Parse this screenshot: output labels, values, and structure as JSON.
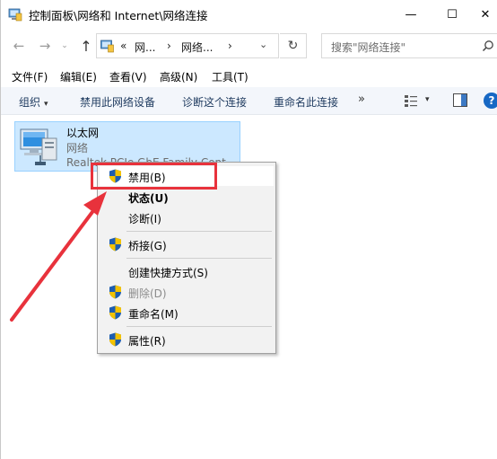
{
  "window": {
    "title": "控制面板\\网络和 Internet\\网络连接",
    "min_glyph": "—",
    "max_glyph": "☐",
    "close_glyph": "✕"
  },
  "nav": {
    "back_glyph": "←",
    "fwd_glyph": "→",
    "recent_glyph": "⌄",
    "up_glyph": "↑",
    "address_overflow": "«",
    "address_seg1": "网...",
    "address_sep1": "›",
    "address_seg2": "网络...",
    "address_sep2": "›",
    "address_dropdown_glyph": "⌄",
    "refresh_glyph": "↻",
    "search_placeholder": "搜索\"网络连接\""
  },
  "menubar": {
    "items": [
      "文件(F)",
      "编辑(E)",
      "查看(V)",
      "高级(N)",
      "工具(T)"
    ]
  },
  "commandbar": {
    "organize": "组织",
    "organize_arrow": "▾",
    "disable_device": "禁用此网络设备",
    "diagnose": "诊断这个连接",
    "rename": "重命名此连接",
    "more": "»",
    "view_arrow": "▾",
    "help": "?"
  },
  "connection": {
    "name": "以太网",
    "status": "网络",
    "device": "Realtek PCIe GbE Family Cont..."
  },
  "context_menu": {
    "items": [
      {
        "label": "禁用(B)",
        "shield": true,
        "bold": false,
        "disabled": false
      },
      {
        "label": "状态(U)",
        "shield": false,
        "bold": true,
        "disabled": false
      },
      {
        "label": "诊断(I)",
        "shield": false,
        "bold": false,
        "disabled": false
      },
      {
        "label": "桥接(G)",
        "shield": true,
        "bold": false,
        "disabled": false
      },
      {
        "label": "创建快捷方式(S)",
        "shield": false,
        "bold": false,
        "disabled": false
      },
      {
        "label": "删除(D)",
        "shield": true,
        "bold": false,
        "disabled": true
      },
      {
        "label": "重命名(M)",
        "shield": true,
        "bold": false,
        "disabled": false
      },
      {
        "label": "属性(R)",
        "shield": true,
        "bold": false,
        "disabled": false
      }
    ]
  },
  "colors": {
    "annotation_red": "#e8323c",
    "selection_blue": "#cce8ff",
    "help_blue": "#1768c4"
  }
}
